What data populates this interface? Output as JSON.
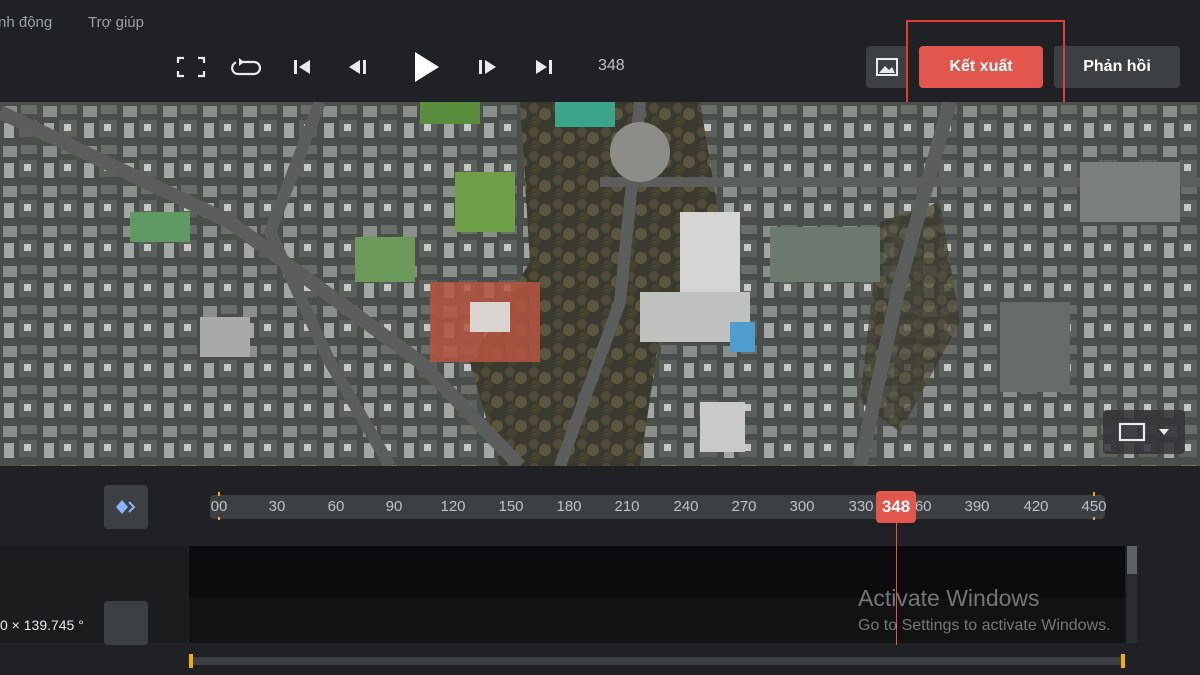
{
  "menu": {
    "items": [
      "nh động",
      "Trợ giúp"
    ]
  },
  "toolbar": {
    "frame_counter": "348",
    "export_label": "Kết xuất",
    "feedback_label": "Phản hồi"
  },
  "timeline": {
    "ticks": [
      "00",
      "30",
      "60",
      "90",
      "120",
      "150",
      "180",
      "210",
      "240",
      "270",
      "300",
      "330",
      "360",
      "390",
      "420",
      "450"
    ],
    "current_frame": "348"
  },
  "left_panel": {
    "coord_text": "0 × 139.745 °"
  },
  "watermark": {
    "title": "Activate Windows",
    "subtitle": "Go to Settings to activate Windows."
  },
  "colors": {
    "accent": "#e2564d",
    "highlight": "#e53935",
    "handle": "#f9ab00"
  }
}
